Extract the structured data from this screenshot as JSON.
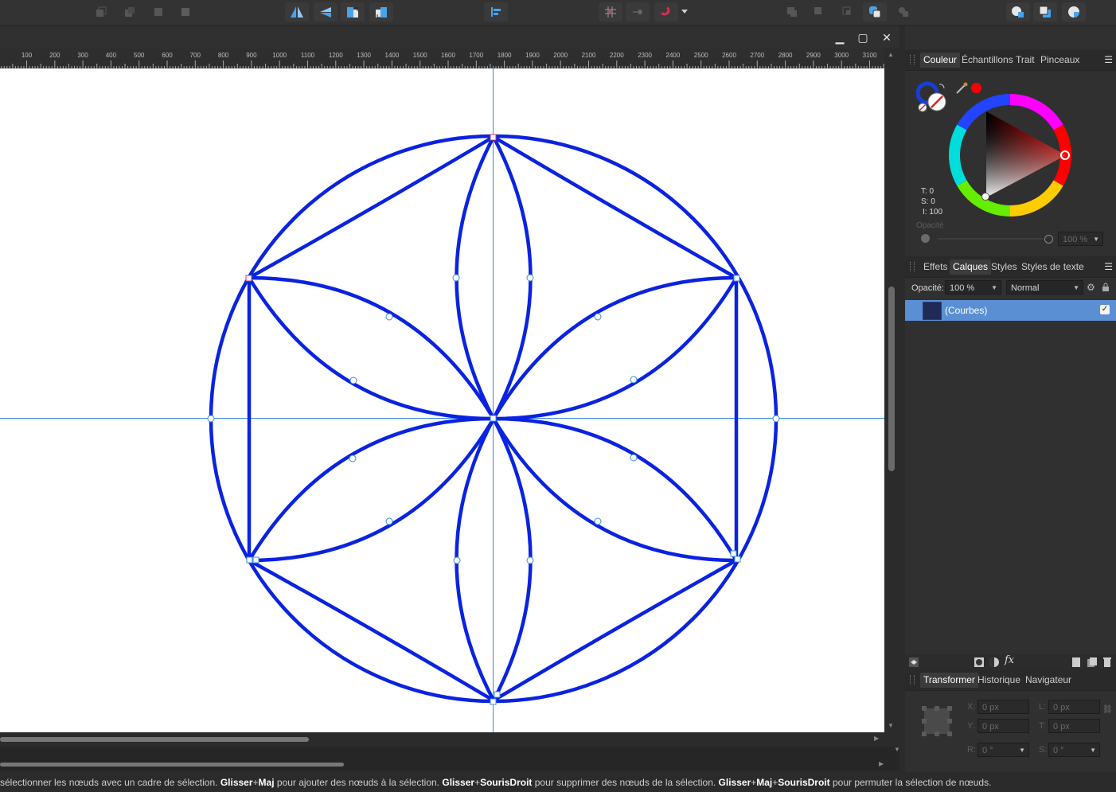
{
  "window": {
    "minimize": "▁",
    "maximize": "▢",
    "close": "✕"
  },
  "toolbar": {
    "groups": [
      {
        "icons": [
          "arrange-back-icon",
          "arrange-backward-icon",
          "arrange-forward-icon",
          "arrange-front-icon"
        ]
      },
      {
        "icons": [
          "flip-horizontal-icon",
          "flip-vertical-icon",
          "rotate-left-icon",
          "rotate-right-icon"
        ]
      },
      {
        "icons": [
          "align-left-icon"
        ]
      },
      {
        "icons": [
          "grid-snap-icon",
          "snap-baseline-icon",
          "magnet-snapping-icon",
          "chevron-down-icon"
        ]
      },
      {
        "icons": [
          "boolean-add-icon",
          "boolean-subtract-icon",
          "boolean-intersect-icon",
          "boolean-xor-icon",
          "boolean-divide-icon"
        ]
      },
      {
        "icons": [
          "insert-behind-icon",
          "insert-top-icon",
          "insert-inside-icon"
        ]
      }
    ]
  },
  "ruler": {
    "labels": [
      "100",
      "200",
      "300",
      "400",
      "500",
      "600",
      "700",
      "800",
      "900",
      "1000",
      "1100",
      "1200",
      "1300",
      "1400",
      "1500",
      "1600",
      "1700",
      "1800",
      "1900",
      "2000",
      "2100",
      "2200",
      "2300",
      "2400",
      "2500",
      "2600",
      "2700",
      "2800",
      "2900",
      "3000",
      "3100"
    ]
  },
  "color_panel": {
    "tabs": [
      "Couleur",
      "Échantillons",
      "Trait",
      "Pinceaux"
    ],
    "active_tab": "Couleur",
    "readout": {
      "t": "T: 0",
      "s": "S: 0",
      "l": "I: 100"
    },
    "opacity_label": "Opacité",
    "opacity_value": "100 %",
    "fill_color": "#1a3dd6",
    "accent": "#ff0000"
  },
  "layers_panel": {
    "tabs": [
      "Effets",
      "Calques",
      "Styles",
      "Styles de texte"
    ],
    "active_tab": "Calques",
    "opacity_label": "Opacité:",
    "opacity_value": "100 %",
    "blend_mode": "Normal",
    "layers": [
      {
        "name": "(Courbes)",
        "visible": true,
        "selected": true
      }
    ],
    "selection_color": "#5b8fd4"
  },
  "transform_panel": {
    "tabs": [
      "Transformer",
      "Historique",
      "Navigateur"
    ],
    "active_tab": "Transformer",
    "x_label": "X:",
    "x_value": "0 px",
    "y_label": "Y:",
    "y_value": "0 px",
    "w_label": "L:",
    "w_value": "0 px",
    "h_label": "T:",
    "h_value": "0 px",
    "r_label": "R:",
    "r_value": "0 °",
    "s_label": "S:",
    "s_value": "0 °"
  },
  "status": {
    "part1": "sélectionner les nœuds avec un cadre de sélection. ",
    "k1": "Glisser",
    "plus1": "+",
    "k2": "Maj",
    "part2": " pour ajouter des nœuds à la sélection. ",
    "k3": "Glisser",
    "plus2": "+",
    "k4": "SourisDroit",
    "part3": " pour supprimer des nœuds de la sélection. ",
    "k5": "Glisser",
    "plus3": "+",
    "k6": "Maj",
    "plus4": "+",
    "k7": "SourisDroit",
    "part4": " pour permuter la sélection de nœuds."
  },
  "design": {
    "stroke_color": "#0a23e0",
    "guide_color": "#3a8fd8"
  }
}
